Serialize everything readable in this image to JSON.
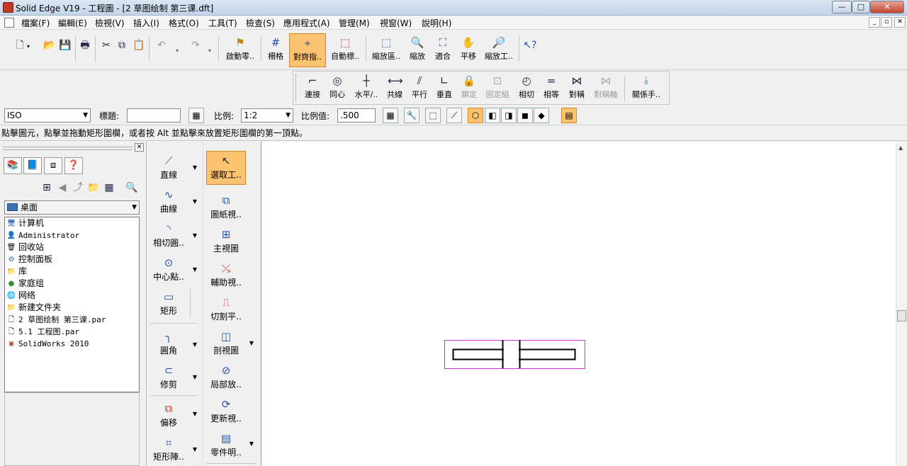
{
  "window": {
    "title": "Solid Edge V19 - 工程圖 - [2 草图绘制 第三课.dft]",
    "minimize": "—",
    "maximize": "□",
    "close": "✕"
  },
  "menubar": {
    "items": [
      "檔案(F)",
      "編輯(E)",
      "檢視(V)",
      "插入(I)",
      "格式(O)",
      "工具(T)",
      "檢查(S)",
      "應用程式(A)",
      "管理(M)",
      "視窗(W)",
      "說明(H)"
    ]
  },
  "toolbar_main": {
    "buttons": [
      {
        "label": "啟動零..",
        "icon": "start-part-icon"
      },
      {
        "label": "柵格",
        "icon": "grid-icon"
      },
      {
        "label": "對齊指..",
        "icon": "align-indicator-icon",
        "active": true
      },
      {
        "label": "自動標..",
        "icon": "auto-dimension-icon"
      },
      {
        "label": "縮放區..",
        "icon": "zoom-area-icon"
      },
      {
        "label": "縮放",
        "icon": "zoom-icon"
      },
      {
        "label": "適合",
        "icon": "fit-icon"
      },
      {
        "label": "平移",
        "icon": "pan-icon"
      },
      {
        "label": "縮放工..",
        "icon": "zoom-tool-icon"
      }
    ]
  },
  "toolbar_relations": {
    "buttons": [
      {
        "label": "連接",
        "icon": "connect-icon",
        "enabled": true
      },
      {
        "label": "同心",
        "icon": "concentric-icon",
        "enabled": true
      },
      {
        "label": "水平/..",
        "icon": "horizontal-vertical-icon",
        "enabled": true
      },
      {
        "label": "共線",
        "icon": "collinear-icon",
        "enabled": true
      },
      {
        "label": "平行",
        "icon": "parallel-icon",
        "enabled": true
      },
      {
        "label": "垂直",
        "icon": "perpendicular-icon",
        "enabled": true
      },
      {
        "label": "鎖定",
        "icon": "lock-icon",
        "enabled": false
      },
      {
        "label": "固定組",
        "icon": "rigid-set-icon",
        "enabled": false
      },
      {
        "label": "相切",
        "icon": "tangent-icon",
        "enabled": true
      },
      {
        "label": "相等",
        "icon": "equal-icon",
        "enabled": true
      },
      {
        "label": "對稱",
        "icon": "symmetric-icon",
        "enabled": true
      },
      {
        "label": "對稱軸",
        "icon": "symmetry-axis-icon",
        "enabled": false
      },
      {
        "label": "關係手..",
        "icon": "relationship-handles-icon",
        "enabled": true
      }
    ]
  },
  "ribbon": {
    "style_value": "ISO",
    "title_label": "標題:",
    "title_value": "",
    "scale_label": "比例:",
    "scale_value": "1:2",
    "scale_value_label": "比例值:",
    "scale_number": ".500"
  },
  "prompt": "點擊圖元，點擊並拖動矩形圍欄，或者按 Alt 並點擊來放置矩形圍欄的第一頂點。",
  "library": {
    "location": "桌面",
    "items": [
      {
        "name": "计算机",
        "mono": false
      },
      {
        "name": "Administrator",
        "mono": true
      },
      {
        "name": "回收站",
        "mono": false
      },
      {
        "name": "控制面板",
        "mono": false
      },
      {
        "name": "库",
        "mono": false
      },
      {
        "name": "家庭组",
        "mono": false
      },
      {
        "name": "网络",
        "mono": false
      },
      {
        "name": "新建文件夹",
        "mono": false
      },
      {
        "name": "2 草图绘制 第三课.par",
        "mono": true
      },
      {
        "name": "5.1 工程图.par",
        "mono": true
      },
      {
        "name": "SolidWorks 2010",
        "mono": true
      }
    ]
  },
  "draw_tools": [
    {
      "label": "直線",
      "icon": "line-icon"
    },
    {
      "label": "曲線",
      "icon": "curve-icon"
    },
    {
      "label": "相切圓..",
      "icon": "tangent-arc-icon"
    },
    {
      "label": "中心點..",
      "icon": "center-circle-icon"
    },
    {
      "label": "矩形",
      "icon": "rectangle-icon"
    },
    {
      "label": "圓角",
      "icon": "fillet-icon"
    },
    {
      "label": "修剪",
      "icon": "trim-icon"
    },
    {
      "label": "偏移",
      "icon": "offset-icon"
    },
    {
      "label": "矩形陣..",
      "icon": "rect-pattern-icon"
    }
  ],
  "view_tools": [
    {
      "label": "選取工..",
      "icon": "select-tool-icon",
      "active": true
    },
    {
      "label": "圖紙視..",
      "icon": "drawing-view-icon"
    },
    {
      "label": "主視圖",
      "icon": "principal-view-icon"
    },
    {
      "label": "輔助視..",
      "icon": "auxiliary-view-icon"
    },
    {
      "label": "切割平..",
      "icon": "cutting-plane-icon"
    },
    {
      "label": "剖視圖",
      "icon": "section-view-icon"
    },
    {
      "label": "局部放..",
      "icon": "detail-view-icon"
    },
    {
      "label": "更新視..",
      "icon": "update-view-icon"
    },
    {
      "label": "零件明..",
      "icon": "parts-list-icon"
    }
  ],
  "colors": {
    "accent": "#fbc271",
    "selection": "#cc33cc",
    "canvas": "#ffffff"
  }
}
